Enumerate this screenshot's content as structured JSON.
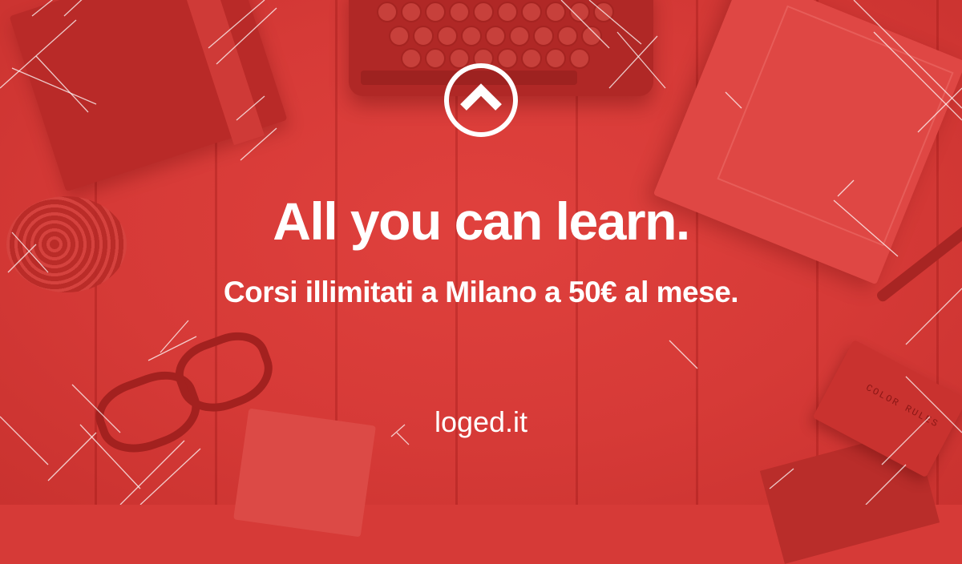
{
  "banner": {
    "headline": "All you can learn.",
    "subline": "Corsi illimitati a Milano a 50€ al mese.",
    "site": "loged.it",
    "color_box_label": "COLOR RULES"
  },
  "logo": {
    "icon": "chevron-up-icon"
  },
  "colors": {
    "background": "#d63a37",
    "text": "#ffffff"
  }
}
